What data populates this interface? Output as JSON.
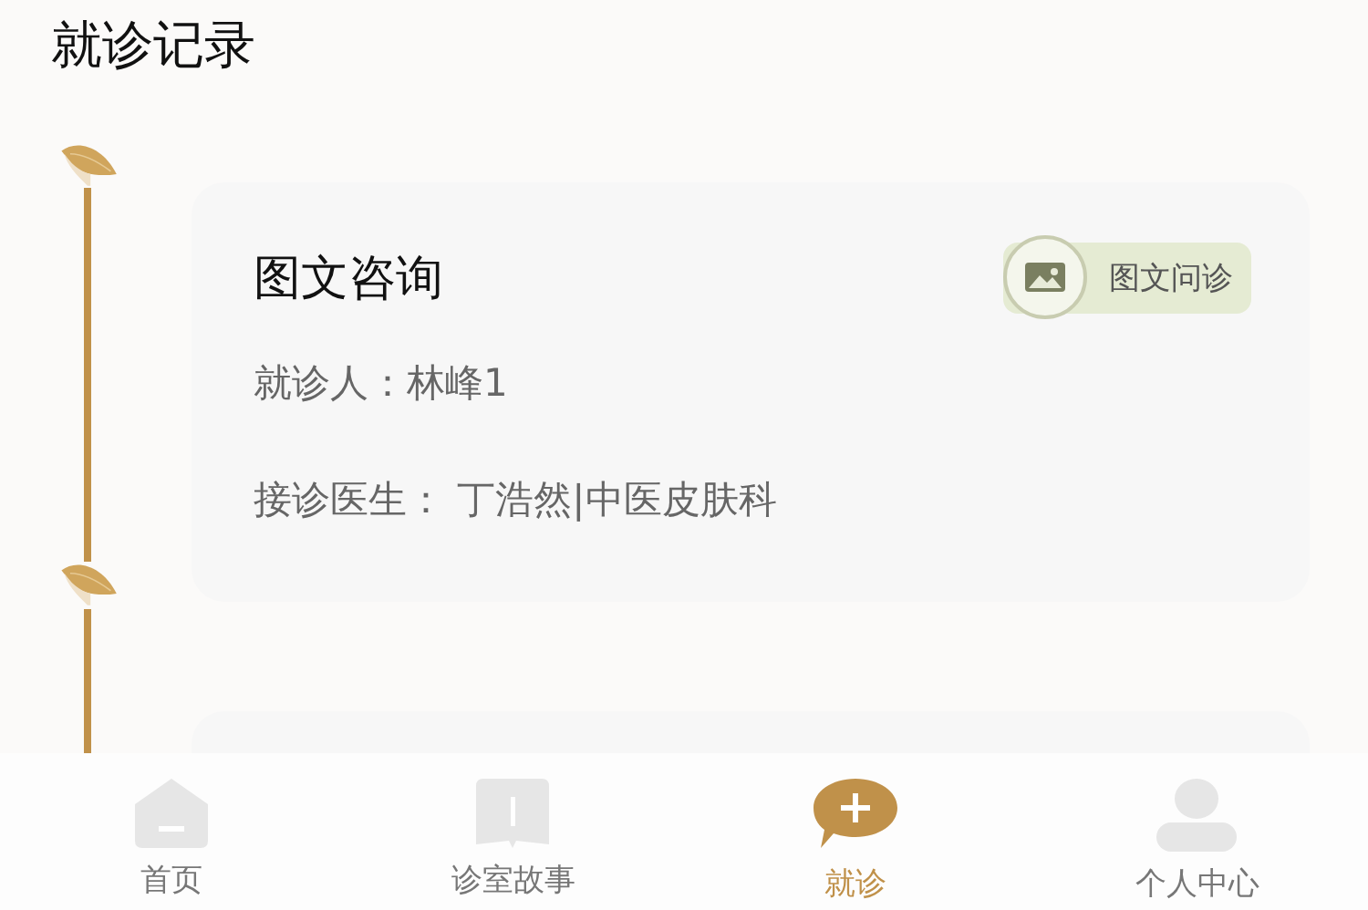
{
  "header": {
    "title": "就诊记录"
  },
  "records": [
    {
      "kind": "full",
      "title": "图文咨询",
      "badge": "图文问诊",
      "patient": "就诊人：林峰1",
      "doctor": "接诊医生： 丁浩然|中医皮肤科"
    },
    {
      "kind": "cut"
    }
  ],
  "tabs": [
    {
      "kind": "home",
      "label": "首页",
      "selected": false
    },
    {
      "kind": "book",
      "label": "诊室故事",
      "selected": false
    },
    {
      "kind": "consult",
      "label": "就诊",
      "selected": true
    },
    {
      "kind": "person",
      "label": "个人中心",
      "selected": false
    }
  ]
}
